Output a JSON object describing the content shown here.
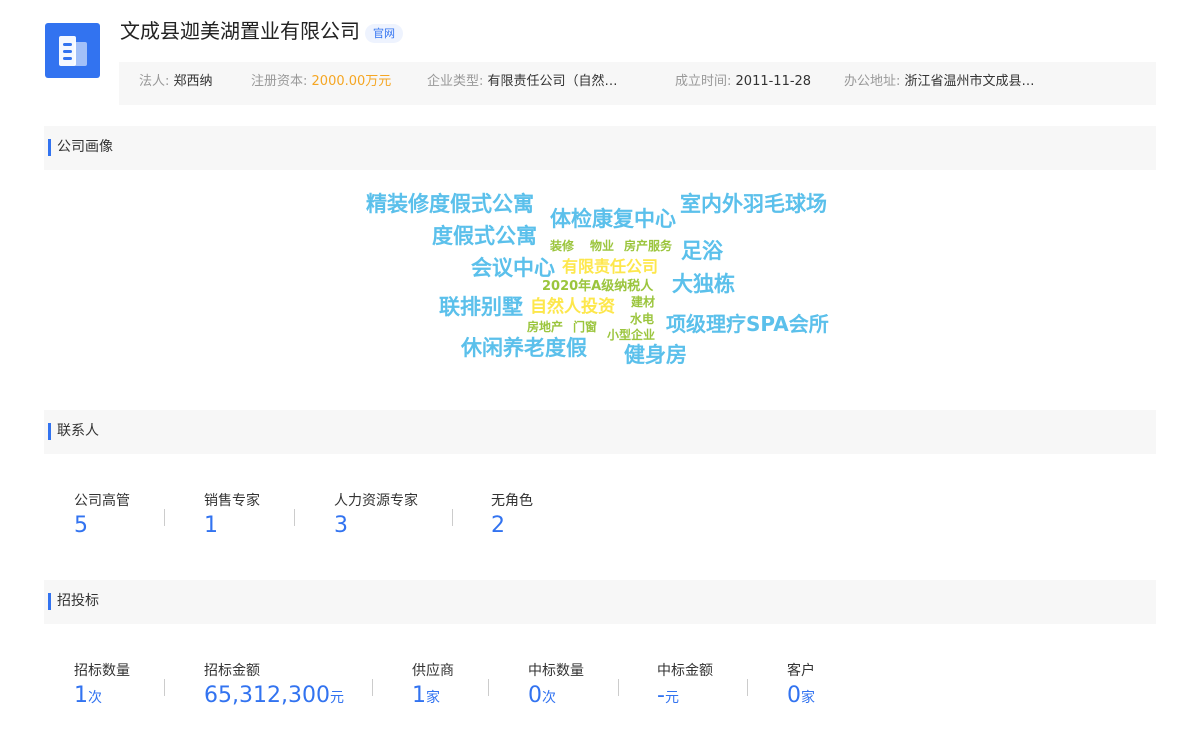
{
  "company": {
    "name": "文成县迦美湖置业有限公司",
    "official_tag": "官网"
  },
  "info": {
    "legal_person_label": "法人:",
    "legal_person": "郑西纳",
    "capital_label": "注册资本:",
    "capital": "2000.00万元",
    "type_label": "企业类型:",
    "type": "有限责任公司（自然…",
    "founded_label": "成立时间:",
    "founded": "2011-11-28",
    "address_label": "办公地址:",
    "address": "浙江省温州市文成县…"
  },
  "sections": {
    "portrait": "公司画像",
    "contacts": "联系人",
    "bidding": "招投标"
  },
  "word_cloud": {
    "colors": {
      "blue": "#5bc0eb",
      "green": "#9bc53d",
      "orange": "#fde74c"
    },
    "words": [
      "精装修度假式公寓",
      "体检康复中心",
      "室内外羽毛球场",
      "度假式公寓",
      "装修",
      "物业",
      "房产服务",
      "足浴",
      "会议中心",
      "有限责任公司",
      "2020年A级纳税人",
      "大独栋",
      "联排别墅",
      "自然人投资",
      "建材",
      "水电",
      "房地产",
      "门窗",
      "小型企业",
      "项级理疗SPA会所",
      "休闲养老度假",
      "健身房"
    ]
  },
  "contacts": [
    {
      "label": "公司高管",
      "value": "5"
    },
    {
      "label": "销售专家",
      "value": "1"
    },
    {
      "label": "人力资源专家",
      "value": "3"
    },
    {
      "label": "无角色",
      "value": "2"
    }
  ],
  "bidding": [
    {
      "label": "招标数量",
      "value": "1",
      "unit": "次"
    },
    {
      "label": "招标金额",
      "value": "65,312,300",
      "unit": "元"
    },
    {
      "label": "供应商",
      "value": "1",
      "unit": "家"
    },
    {
      "label": "中标数量",
      "value": "0",
      "unit": "次"
    },
    {
      "label": "中标金额",
      "value": "-",
      "unit": "元"
    },
    {
      "label": "客户",
      "value": "0",
      "unit": "家"
    }
  ]
}
